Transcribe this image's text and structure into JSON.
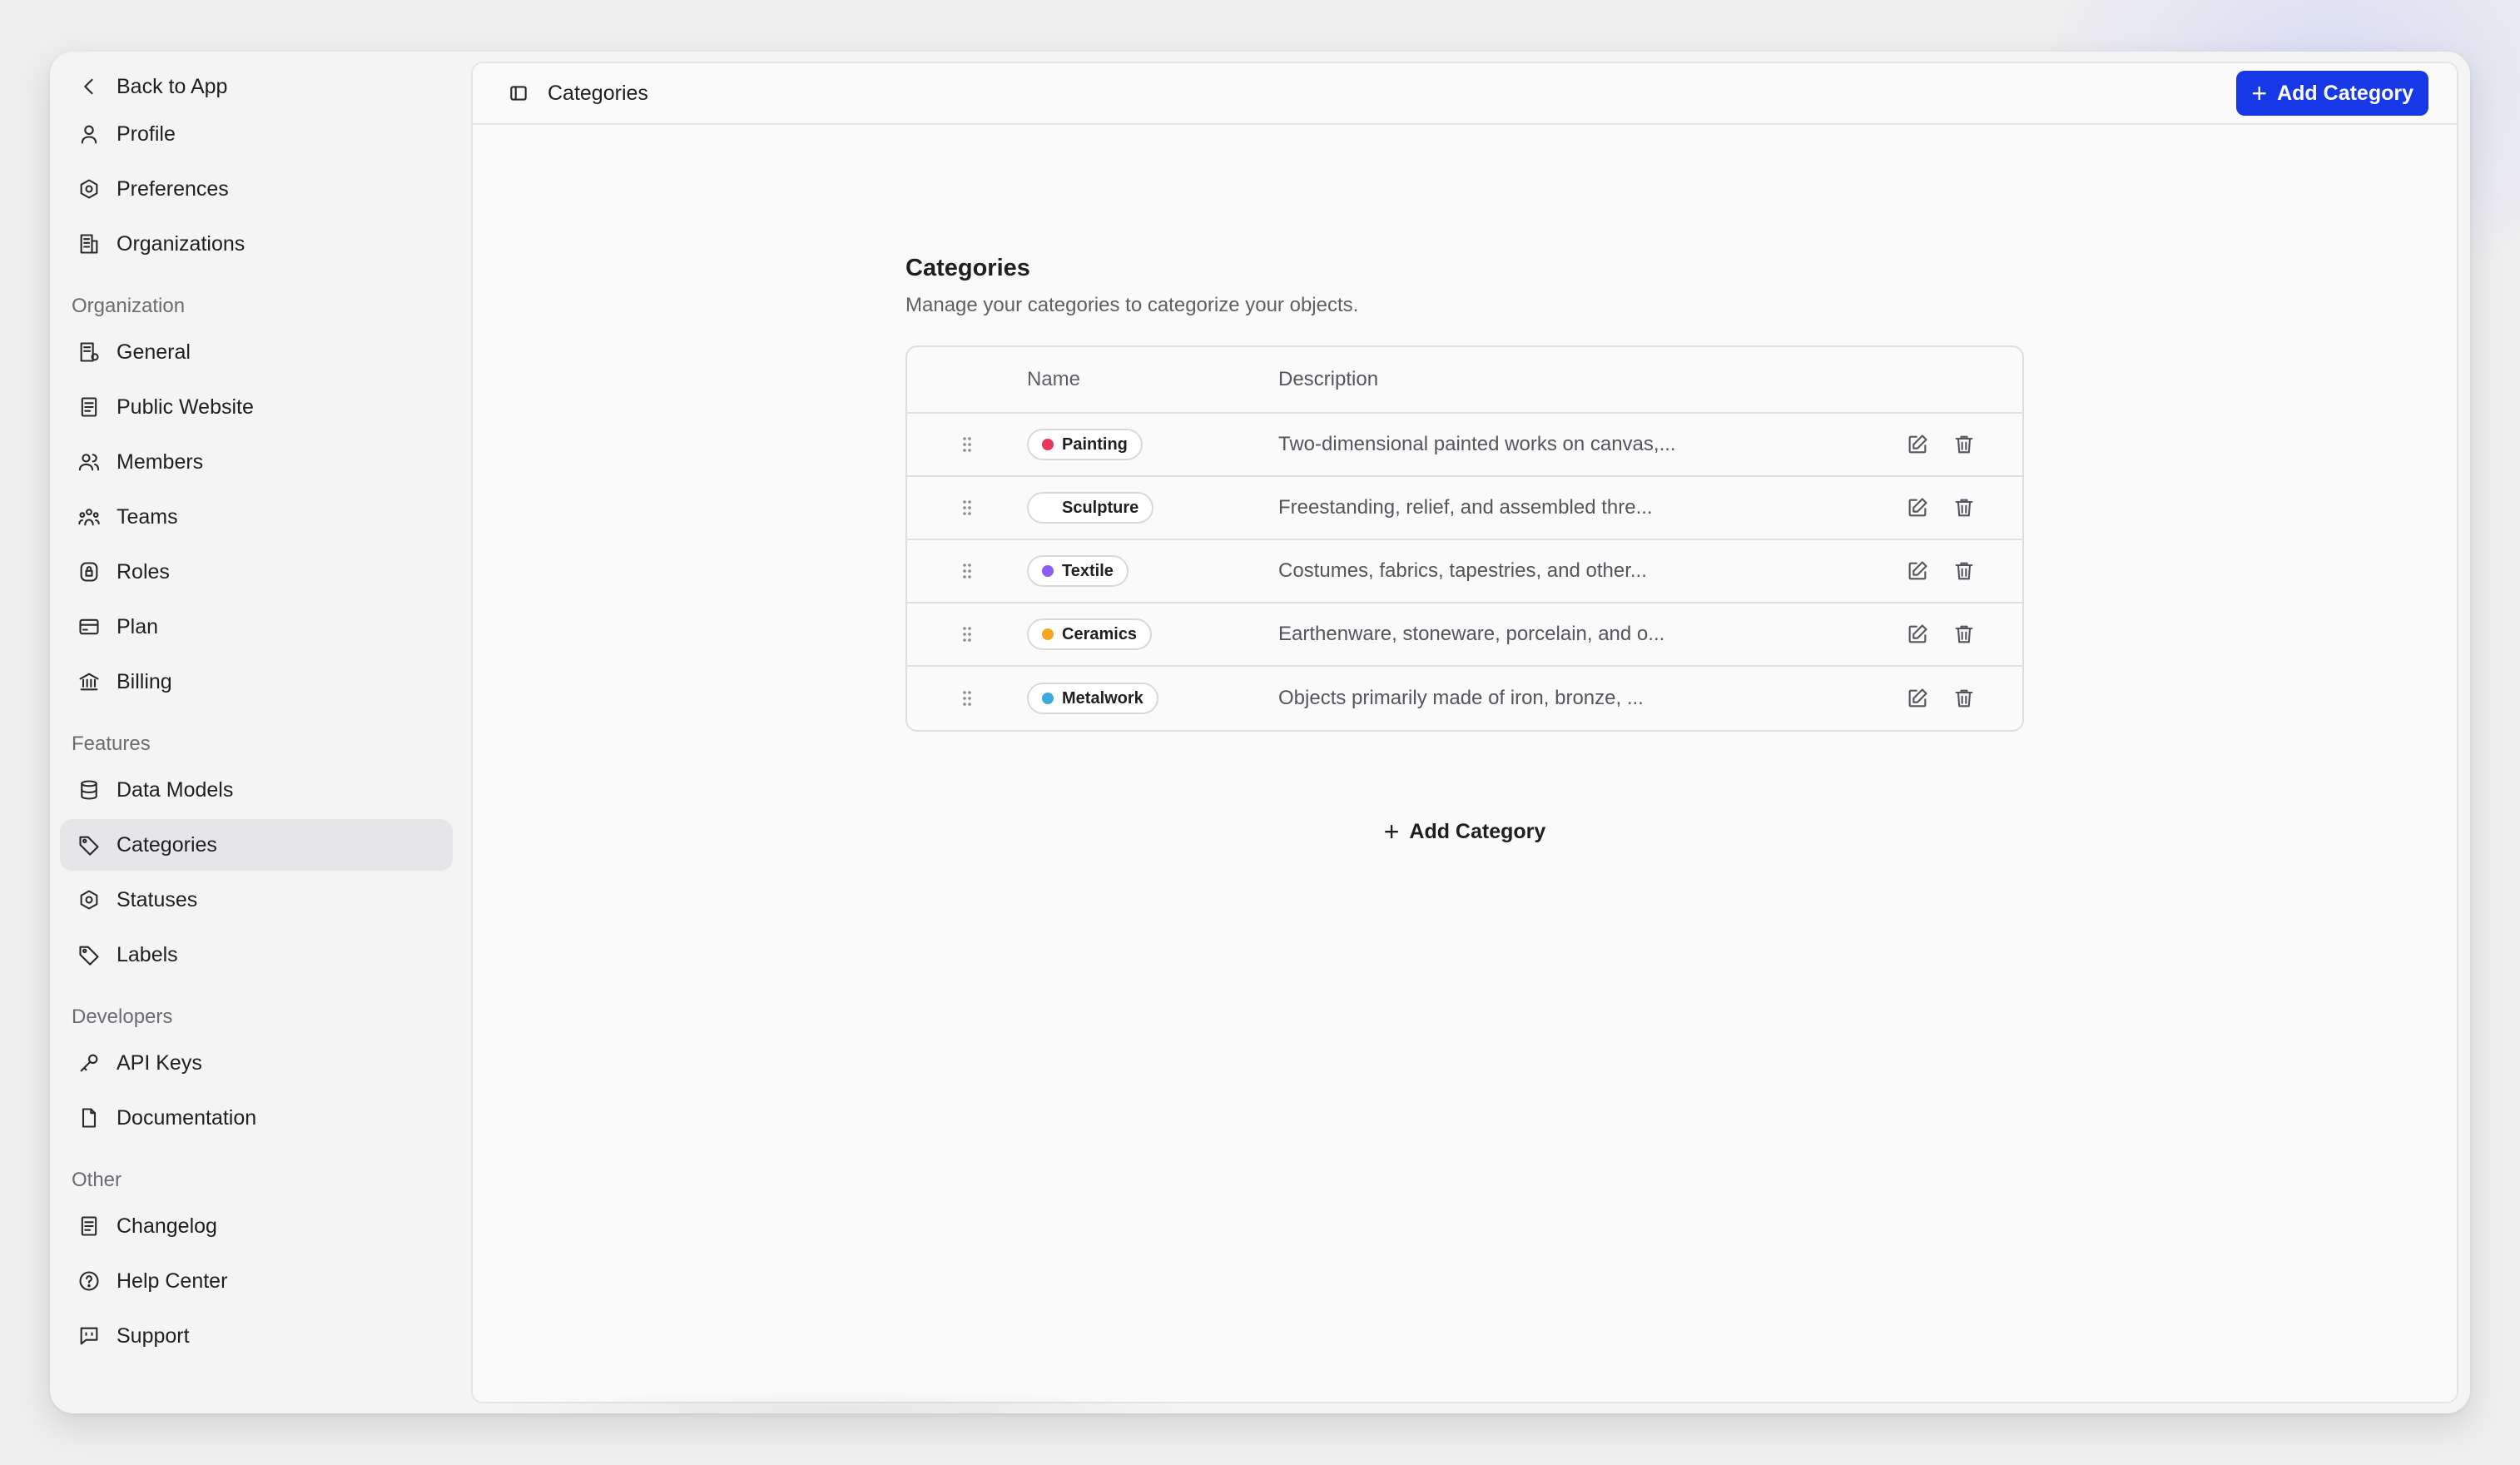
{
  "sidebar": {
    "back": {
      "label": "Back to App",
      "icon": "chevron-left-icon"
    },
    "account": [
      {
        "label": "Profile",
        "icon": "user-icon"
      },
      {
        "label": "Preferences",
        "icon": "settings-hex-icon"
      },
      {
        "label": "Organizations",
        "icon": "building-icon"
      }
    ],
    "sections": [
      {
        "title": "Organization",
        "items": [
          {
            "label": "General",
            "icon": "building-gear-icon"
          },
          {
            "label": "Public Website",
            "icon": "document-list-icon"
          },
          {
            "label": "Members",
            "icon": "users-icon"
          },
          {
            "label": "Teams",
            "icon": "team-icon"
          },
          {
            "label": "Roles",
            "icon": "shield-lock-icon"
          },
          {
            "label": "Plan",
            "icon": "credit-card-icon"
          },
          {
            "label": "Billing",
            "icon": "bank-icon"
          }
        ]
      },
      {
        "title": "Features",
        "items": [
          {
            "label": "Data Models",
            "icon": "database-icon"
          },
          {
            "label": "Categories",
            "icon": "tag-icon",
            "active": true
          },
          {
            "label": "Statuses",
            "icon": "settings-hex-icon"
          },
          {
            "label": "Labels",
            "icon": "tag-icon"
          }
        ]
      },
      {
        "title": "Developers",
        "items": [
          {
            "label": "API Keys",
            "icon": "key-icon"
          },
          {
            "label": "Documentation",
            "icon": "file-icon"
          }
        ]
      },
      {
        "title": "Other",
        "items": [
          {
            "label": "Changelog",
            "icon": "document-list-icon"
          },
          {
            "label": "Help Center",
            "icon": "help-icon"
          },
          {
            "label": "Support",
            "icon": "chat-icon"
          }
        ]
      }
    ]
  },
  "topbar": {
    "title": "Categories",
    "add_button": "Add Category"
  },
  "page": {
    "title": "Categories",
    "subtitle": "Manage your categories to categorize your objects.",
    "columns": {
      "name": "Name",
      "description": "Description"
    },
    "rows": [
      {
        "name": "Painting",
        "color": "#e8365d",
        "description": "Two-dimensional painted works on canvas,..."
      },
      {
        "name": "Sculpture",
        "color": "",
        "description": "Freestanding, relief, and assembled thre..."
      },
      {
        "name": "Textile",
        "color": "#8b5cf6",
        "description": "Costumes, fabrics, tapestries, and other..."
      },
      {
        "name": "Ceramics",
        "color": "#f5a623",
        "description": "Earthenware, stoneware, porcelain, and o..."
      },
      {
        "name": "Metalwork",
        "color": "#3aa9dc",
        "description": "Objects primarily made of iron, bronze, ..."
      }
    ],
    "add_link": "Add Category"
  },
  "colors": {
    "accent": "#1638e6"
  }
}
